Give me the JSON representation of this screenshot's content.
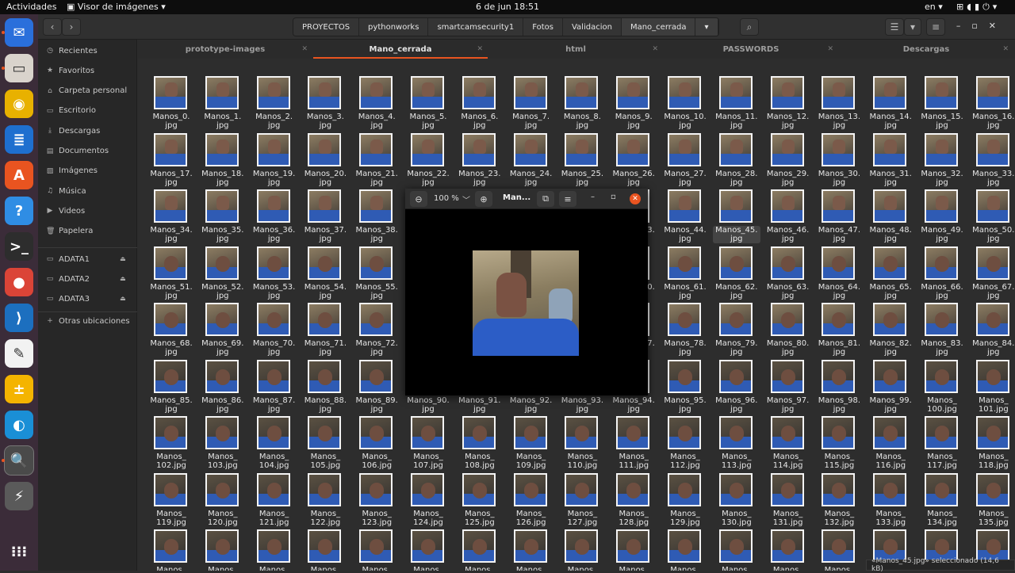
{
  "topbar": {
    "activities": "Actividades",
    "app_menu": "Visor de imágenes",
    "clock": "6 de jun  18:51",
    "lang": "en"
  },
  "dock": [
    {
      "name": "thunderbird-icon",
      "color": "#2a6fdb",
      "glyph": "✉",
      "running": true
    },
    {
      "name": "files-icon",
      "color": "#d9d3cc",
      "glyph": "▭",
      "running": true
    },
    {
      "name": "rhythmbox-icon",
      "color": "#e8b100",
      "glyph": "◉",
      "running": false
    },
    {
      "name": "writer-icon",
      "color": "#1e6fcf",
      "glyph": "≣",
      "running": false
    },
    {
      "name": "software-icon",
      "color": "#e95420",
      "glyph": "A",
      "running": false
    },
    {
      "name": "help-icon",
      "color": "#2f8de4",
      "glyph": "?",
      "running": false
    },
    {
      "name": "terminal-icon",
      "color": "#2d2d2d",
      "glyph": ">_",
      "running": false
    },
    {
      "name": "chrome-icon",
      "color": "#db4437",
      "glyph": "●",
      "running": false
    },
    {
      "name": "vscode-icon",
      "color": "#1c6fbf",
      "glyph": "⟩",
      "running": false
    },
    {
      "name": "inkscape-icon",
      "color": "#f2f2f2",
      "glyph": "✎",
      "running": false
    },
    {
      "name": "notes-icon",
      "color": "#f4b400",
      "glyph": "±",
      "running": false
    },
    {
      "name": "edge-icon",
      "color": "#1a8fd6",
      "glyph": "◐",
      "running": false
    },
    {
      "name": "image-viewer-icon",
      "color": "#4a4a4a",
      "glyph": "🔍",
      "running": true
    },
    {
      "name": "usb-drive-icon",
      "color": "#5a5a5a",
      "glyph": "⚡",
      "running": false
    }
  ],
  "pathbar": {
    "crumbs": [
      "PROYECTOS",
      "pythonworks",
      "smartcamsecurity1",
      "Fotos",
      "Validacion",
      "Mano_cerrada"
    ]
  },
  "sidebar": {
    "items": [
      "Recientes",
      "Favoritos",
      "Carpeta personal",
      "Escritorio",
      "Descargas",
      "Documentos",
      "Imágenes",
      "Música",
      "Videos",
      "Papelera"
    ],
    "devices": [
      "ADATA1",
      "ADATA2",
      "ADATA3"
    ],
    "other": "Otras ubicaciones"
  },
  "tabs": [
    {
      "label": "prototype-images",
      "active": false
    },
    {
      "label": "Mano_cerrada",
      "active": true
    },
    {
      "label": "html",
      "active": false
    },
    {
      "label": "PASSWORDS",
      "active": false
    },
    {
      "label": "Descargas",
      "active": false
    }
  ],
  "grid": {
    "prefix": "Manos_",
    "ext": ".jpg",
    "count": 153,
    "selected_index": 45
  },
  "viewer": {
    "zoom": "100 %",
    "title": "Man..."
  },
  "status": "«Manos_45.jpg» seleccionado (14,6 kB)"
}
